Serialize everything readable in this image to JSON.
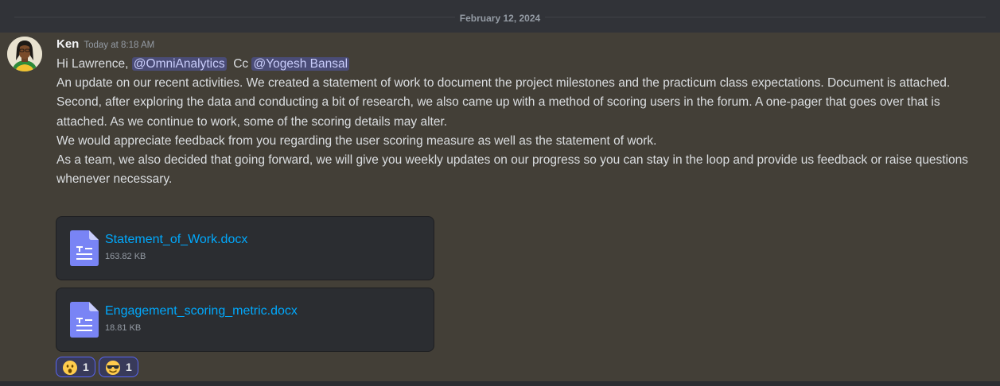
{
  "date_divider": "February 12, 2024",
  "message": {
    "author": "Ken",
    "timestamp": "Today at 8:18 AM",
    "greeting": "Hi Lawrence,",
    "mention1": "@OmniAnalytics",
    "cc": "Cc",
    "mention2": "@Yogesh Bansal",
    "paragraphs": [
      "An update on our recent activities. We created a statement of work to document the project milestones and the practicum class expectations.  Document is attached.",
      "Second, after exploring the data and conducting a bit of research, we also came up with a method of scoring users in the forum. A one-pager that goes over that is attached.  As we continue to work, some of the scoring details may alter.",
      "We would appreciate feedback from you regarding the user scoring measure as well as the statement of work.",
      "As a team, we also decided that going forward, we will give you weekly updates on our progress so you can stay in the loop and provide us feedback or raise questions whenever necessary."
    ],
    "attachments": [
      {
        "name": "Statement_of_Work.docx",
        "size": "163.82 KB",
        "icon": "document-icon"
      },
      {
        "name": "Engagement_scoring_metric.docx",
        "size": "18.81 KB",
        "icon": "document-icon"
      }
    ],
    "reactions": [
      {
        "emoji": "astonished-face-icon",
        "count": "1"
      },
      {
        "emoji": "sunglasses-face-icon",
        "count": "1"
      }
    ]
  },
  "colors": {
    "background": "#313338",
    "message_highlight": "#433f37",
    "link": "#00a8fc",
    "mention_bg": "#5865f2",
    "attachment_bg": "#2b2d31"
  }
}
